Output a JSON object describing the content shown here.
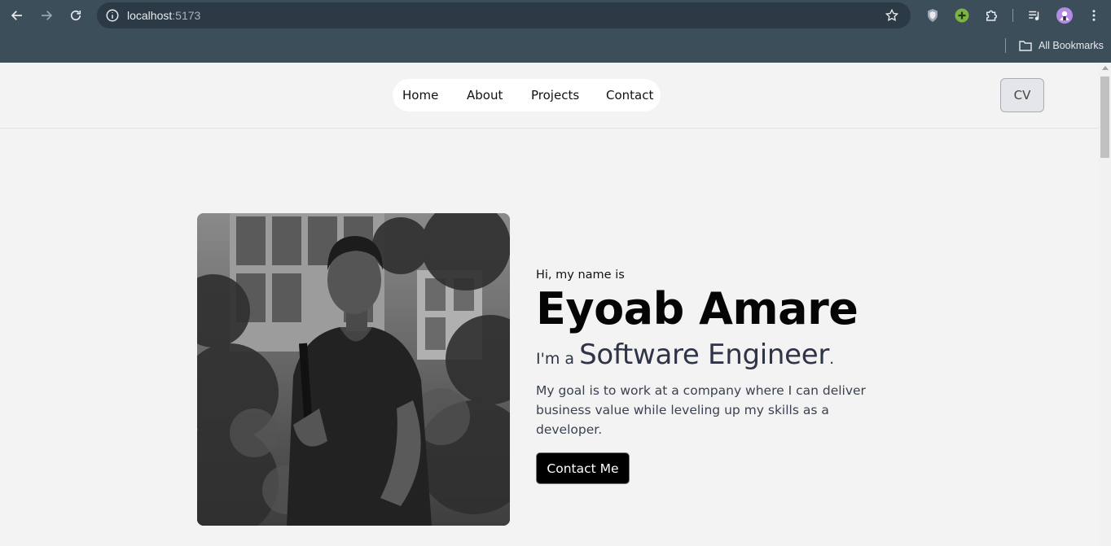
{
  "browser": {
    "url_host": "localhost",
    "url_port": ":5173",
    "bookmarks_label": "All Bookmarks"
  },
  "nav": {
    "links": [
      "Home",
      "About",
      "Projects",
      "Contact"
    ],
    "cv_label": "CV"
  },
  "hero": {
    "greeting": "Hi, my name is",
    "name": "Eyoab Amare",
    "role_prefix": "I'm a ",
    "role_title": "Software Engineer",
    "role_suffix": ".",
    "goal": "My goal is to work at a company where I can deliver business value while leveling up my skills as a developer.",
    "contact_label": "Contact Me"
  },
  "colors": {
    "chrome": "#3b4e5a",
    "omnibox": "#2b3a44",
    "page_bg": "#f3f3f3",
    "button_bg": "#000000"
  },
  "icons": [
    "back-icon",
    "forward-icon",
    "reload-icon",
    "info-icon",
    "star-icon",
    "shield-extension-icon",
    "plus-extension-icon",
    "puzzle-icon",
    "media-icon",
    "profile-avatar",
    "more-icon",
    "folder-icon"
  ]
}
